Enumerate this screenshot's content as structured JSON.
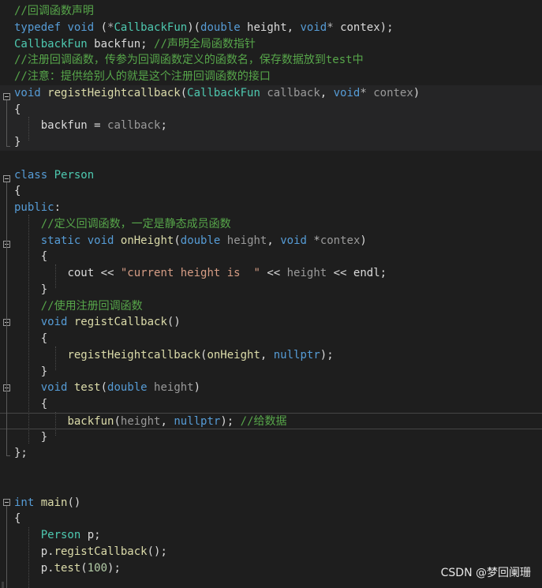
{
  "editor": {
    "watermark": "CSDN @梦回阑珊",
    "colors": {
      "background": "#1e1e1e",
      "keyword": "#569cd6",
      "type": "#4ec9b0",
      "function": "#dcdcaa",
      "comment": "#57a64a",
      "string": "#d69d85",
      "number": "#b5cea8"
    },
    "lines": [
      [
        [
          "cm",
          "//回调函数声明"
        ]
      ],
      [
        [
          "kw",
          "typedef"
        ],
        [
          "id",
          " "
        ],
        [
          "kw",
          "void"
        ],
        [
          "id",
          " ("
        ],
        [
          "op",
          "*"
        ],
        [
          "ty",
          "CallbackFun"
        ],
        [
          "id",
          ")("
        ],
        [
          "kw",
          "double"
        ],
        [
          "id",
          " height, "
        ],
        [
          "kw",
          "void"
        ],
        [
          "op",
          "*"
        ],
        [
          "id",
          " contex);"
        ]
      ],
      [
        [
          "ty",
          "CallbackFun"
        ],
        [
          "id",
          " backfun; "
        ],
        [
          "cm",
          "//声明全局函数指针"
        ]
      ],
      [
        [
          "cm",
          "//注册回调函数，传参为回调函数定义的函数名，保存数据放到test中"
        ]
      ],
      [
        [
          "cm",
          "//注意：提供给别人的就是这个注册回调函数的接口"
        ]
      ],
      [
        [
          "kw",
          "void"
        ],
        [
          "id",
          " "
        ],
        [
          "fn",
          "registHeightcallback"
        ],
        [
          "id",
          "("
        ],
        [
          "ty",
          "CallbackFun"
        ],
        [
          "id",
          " "
        ],
        [
          "pm",
          "callback"
        ],
        [
          "id",
          ", "
        ],
        [
          "kw",
          "void"
        ],
        [
          "op",
          "*"
        ],
        [
          "id",
          " "
        ],
        [
          "pm",
          "contex"
        ],
        [
          "id",
          ")"
        ]
      ],
      [
        [
          "id",
          "{"
        ]
      ],
      [
        [
          "id",
          "    backfun = "
        ],
        [
          "pm",
          "callback"
        ],
        [
          "id",
          ";"
        ]
      ],
      [
        [
          "id",
          "}"
        ]
      ],
      [],
      [
        [
          "kw",
          "class"
        ],
        [
          "id",
          " "
        ],
        [
          "ty",
          "Person"
        ]
      ],
      [
        [
          "id",
          "{"
        ]
      ],
      [
        [
          "kw",
          "public"
        ],
        [
          "id",
          ":"
        ]
      ],
      [
        [
          "id",
          "    "
        ],
        [
          "cm",
          "//定义回调函数，一定是静态成员函数"
        ]
      ],
      [
        [
          "id",
          "    "
        ],
        [
          "kw",
          "static"
        ],
        [
          "id",
          " "
        ],
        [
          "kw",
          "void"
        ],
        [
          "id",
          " "
        ],
        [
          "fn",
          "onHeight"
        ],
        [
          "id",
          "("
        ],
        [
          "kw",
          "double"
        ],
        [
          "id",
          " "
        ],
        [
          "pm",
          "height"
        ],
        [
          "id",
          ", "
        ],
        [
          "kw",
          "void"
        ],
        [
          "id",
          " "
        ],
        [
          "op",
          "*"
        ],
        [
          "pm",
          "contex"
        ],
        [
          "id",
          ")"
        ]
      ],
      [
        [
          "id",
          "    {"
        ]
      ],
      [
        [
          "id",
          "        "
        ],
        [
          "id",
          "cout"
        ],
        [
          "id",
          " << "
        ],
        [
          "st",
          "\"current height is  \""
        ],
        [
          "id",
          " << "
        ],
        [
          "pm",
          "height"
        ],
        [
          "id",
          " << "
        ],
        [
          "id",
          "endl"
        ],
        [
          "id",
          ";"
        ]
      ],
      [
        [
          "id",
          "    }"
        ]
      ],
      [
        [
          "id",
          "    "
        ],
        [
          "cm",
          "//使用注册回调函数"
        ]
      ],
      [
        [
          "id",
          "    "
        ],
        [
          "kw",
          "void"
        ],
        [
          "id",
          " "
        ],
        [
          "fn",
          "registCallback"
        ],
        [
          "id",
          "()"
        ]
      ],
      [
        [
          "id",
          "    {"
        ]
      ],
      [
        [
          "id",
          "        "
        ],
        [
          "fn",
          "registHeightcallback"
        ],
        [
          "id",
          "("
        ],
        [
          "fn",
          "onHeight"
        ],
        [
          "id",
          ", "
        ],
        [
          "kw",
          "nullptr"
        ],
        [
          "id",
          ");"
        ]
      ],
      [
        [
          "id",
          "    }"
        ]
      ],
      [
        [
          "id",
          "    "
        ],
        [
          "kw",
          "void"
        ],
        [
          "id",
          " "
        ],
        [
          "fn",
          "test"
        ],
        [
          "id",
          "("
        ],
        [
          "kw",
          "double"
        ],
        [
          "id",
          " "
        ],
        [
          "pm",
          "height"
        ],
        [
          "id",
          ")"
        ]
      ],
      [
        [
          "id",
          "    {"
        ]
      ],
      [
        [
          "id",
          "        "
        ],
        [
          "fn",
          "backfun"
        ],
        [
          "id",
          "("
        ],
        [
          "pm",
          "height"
        ],
        [
          "id",
          ", "
        ],
        [
          "kw",
          "nullptr"
        ],
        [
          "id",
          "); "
        ],
        [
          "cm",
          "//给数据"
        ]
      ],
      [
        [
          "id",
          "    }"
        ]
      ],
      [
        [
          "id",
          "};"
        ]
      ],
      [],
      [],
      [
        [
          "kw",
          "int"
        ],
        [
          "id",
          " "
        ],
        [
          "fn",
          "main"
        ],
        [
          "id",
          "()"
        ]
      ],
      [
        [
          "id",
          "{"
        ]
      ],
      [
        [
          "id",
          "    "
        ],
        [
          "ty",
          "Person"
        ],
        [
          "id",
          " p;"
        ]
      ],
      [
        [
          "id",
          "    p."
        ],
        [
          "fn",
          "registCallback"
        ],
        [
          "id",
          "();"
        ]
      ],
      [
        [
          "id",
          "    p."
        ],
        [
          "fn",
          "test"
        ],
        [
          "id",
          "("
        ],
        [
          "nu",
          "100"
        ],
        [
          "id",
          ");"
        ]
      ]
    ]
  }
}
